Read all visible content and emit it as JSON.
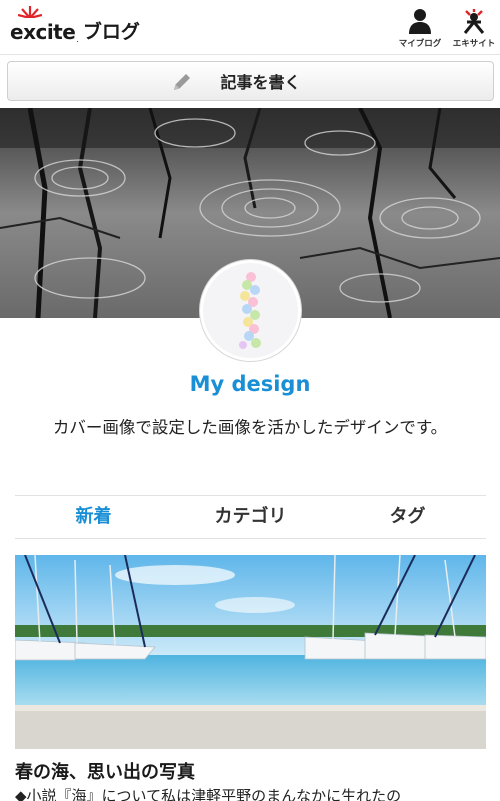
{
  "header": {
    "logo_text": "excite",
    "logo_dot": ".",
    "logo_sub": "ブログ",
    "myblog_label": "マイブログ",
    "excite_label": "エキサイト",
    "myblog_icon": "user-icon",
    "excite_icon": "excite-mascot-icon"
  },
  "write_button": {
    "label": "記事を書く",
    "icon": "pencil-icon"
  },
  "blog": {
    "title": "My design",
    "description": "カバー画像で設定した画像を活かしたデザインです。"
  },
  "tabs": [
    {
      "label": "新着",
      "active": true
    },
    {
      "label": "カテゴリ",
      "active": false
    },
    {
      "label": "タグ",
      "active": false
    }
  ],
  "article": {
    "title": "春の海、思い出の写真",
    "excerpt": "◆小説『海』について私は津軽平野のまんなかに生れたの"
  },
  "colors": {
    "accent": "#1a8fd6",
    "logo_red": "#e0262b"
  }
}
